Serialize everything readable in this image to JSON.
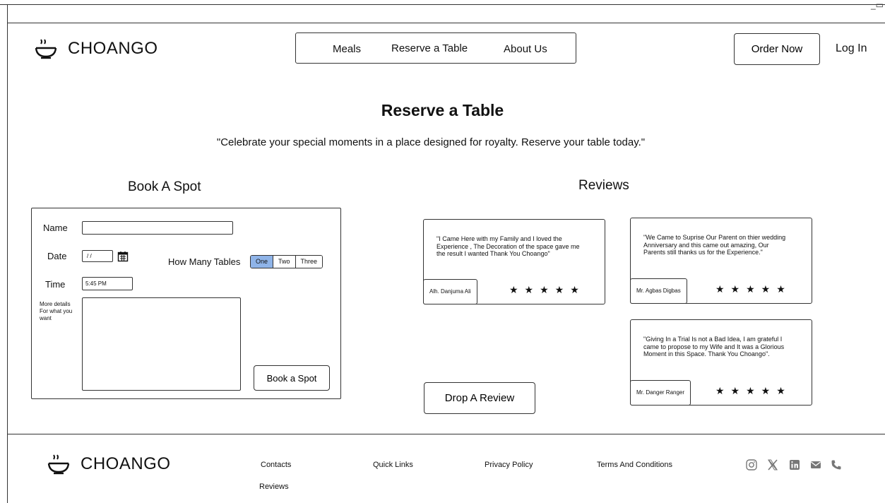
{
  "window": {
    "controls": "_▭"
  },
  "brand": {
    "name": "CHOANGO"
  },
  "nav": {
    "items": [
      "Meals",
      "Reserve a Table",
      "About Us"
    ]
  },
  "header": {
    "order_label": "Order Now",
    "login_label": "Log In"
  },
  "page": {
    "title": "Reserve a Table",
    "tagline": "\"Celebrate your special moments in a place designed for royalty. Reserve your table today.\""
  },
  "booking": {
    "heading": "Book A Spot",
    "name_label": "Name",
    "name_value": "",
    "date_label": "Date",
    "date_value": "/ /",
    "time_label": "Time",
    "time_value": "5:45 PM",
    "details_label": "More details For what you want",
    "tables_label": "How Many Tables",
    "table_options": [
      "One",
      "Two",
      "Three"
    ],
    "table_selected": "One",
    "submit_label": "Book a Spot"
  },
  "reviews": {
    "heading": "Reviews",
    "items": [
      {
        "text": "\"I Came Here with my Family and I loved the Experience , The Decoration of the space gave me the result I wanted Thank You Choango\"",
        "author": "Alh. Danjuma Ali",
        "stars": "★★★★★"
      },
      {
        "text": "\"We Came to Suprise Our Parent on thier wedding Anniversary and this came out amazing, Our Parents still thanks us for the Experience.\"",
        "author": "Mr. Agbas Digbas",
        "stars": "★★★★★"
      },
      {
        "text": "\"Giving In a Trial Is not a Bad Idea, I am grateful I came to propose to my Wife and It was a Glorious Moment in this Space. Thank You Choango\".",
        "author": "Mr. Danger Ranger",
        "stars": "★★★★★"
      }
    ],
    "drop_label": "Drop A Review"
  },
  "footer": {
    "links": [
      "Contacts",
      "Reviews",
      "Quick Links",
      "Privacy Policy",
      "Terms And Conditions"
    ],
    "social_icons": [
      "instagram-icon",
      "x-icon",
      "linkedin-icon",
      "mail-icon",
      "phone-icon"
    ]
  },
  "colors": {
    "accent": "#8fb4e8",
    "stroke": "#333333",
    "icon": "#777777"
  }
}
